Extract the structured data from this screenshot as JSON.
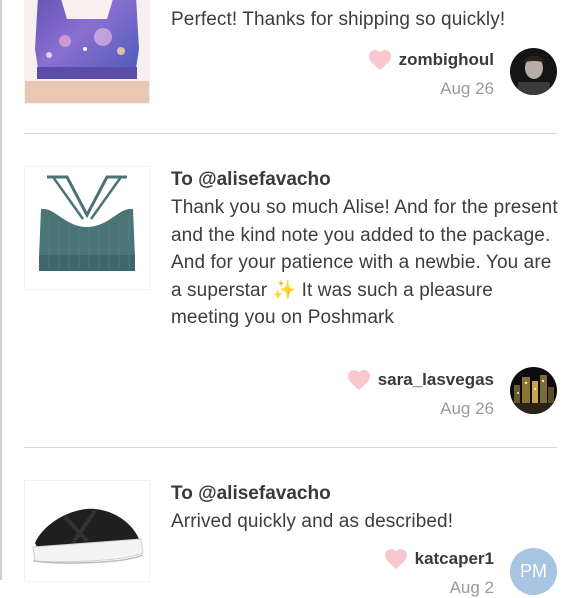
{
  "reviews": [
    {
      "to": "",
      "text": "Perfect! Thanks for shipping so quickly!",
      "username": "zombighoul",
      "date": "Aug 26",
      "product_image": "galaxy-print-sports-bra",
      "avatar": "user-photo-dark"
    },
    {
      "to": "To @alisefavacho",
      "text": "Thank you so much Alise! And for the present and the kind note you added to the package. And for your patience with a newbie. You are a superstar ✨ It was such a pleasure meeting you on Poshmark",
      "username": "sara_lasvegas",
      "date": "Aug 26",
      "product_image": "teal-strappy-sports-bra",
      "avatar": "city-lights-photo"
    },
    {
      "to": "To @alisefavacho",
      "text": "Arrived quickly and as described!",
      "username": "katcaper1",
      "date": "Aug 2",
      "product_image": "black-slide-sandal",
      "avatar_initials": "PM",
      "avatar_color": "#a7c4e3"
    }
  ],
  "colors": {
    "heart": "#f7c9cf",
    "divider": "#d9d9d9",
    "date": "#9a9a9a"
  }
}
